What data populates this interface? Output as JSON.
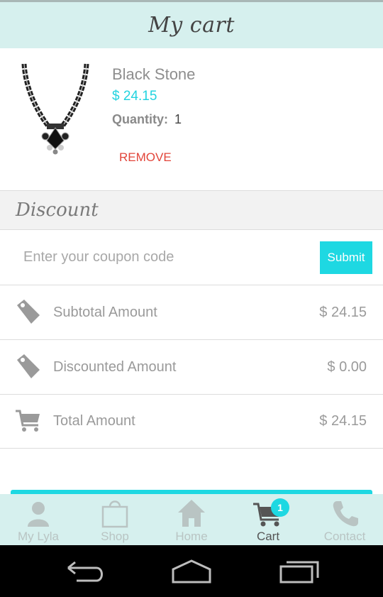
{
  "header": {
    "title": "My cart"
  },
  "cart_item": {
    "name": "Black Stone",
    "price": "$ 24.15",
    "quantity_label": "Quantity:",
    "quantity_value": "1",
    "remove_label": "REMOVE",
    "image_icon": "necklace-image"
  },
  "discount": {
    "title": "Discount",
    "coupon_placeholder": "Enter your coupon code",
    "coupon_value": "",
    "submit_label": "Submit"
  },
  "summary": [
    {
      "label": "Subtotal Amount",
      "value": "$ 24.15",
      "icon": "price-tag-icon"
    },
    {
      "label": "Discounted Amount",
      "value": "$ 0.00",
      "icon": "price-tag-icon"
    },
    {
      "label": "Total Amount",
      "value": "$ 24.15",
      "icon": "cart-icon"
    }
  ],
  "tabs": [
    {
      "label": "My Lyla",
      "icon": "person-icon",
      "active": false
    },
    {
      "label": "Shop",
      "icon": "shopping-bag-icon",
      "active": false
    },
    {
      "label": "Home",
      "icon": "home-icon",
      "active": false
    },
    {
      "label": "Cart",
      "icon": "cart-icon",
      "active": true,
      "badge": "1"
    },
    {
      "label": "Contact",
      "icon": "phone-icon",
      "active": false
    }
  ],
  "system_nav": [
    "back-icon",
    "home-outline-icon",
    "recent-apps-icon"
  ],
  "colors": {
    "accent": "#1ed8e2",
    "header_bg": "#d6f0ee",
    "remove": "#e2453a",
    "price": "#22d3df"
  }
}
